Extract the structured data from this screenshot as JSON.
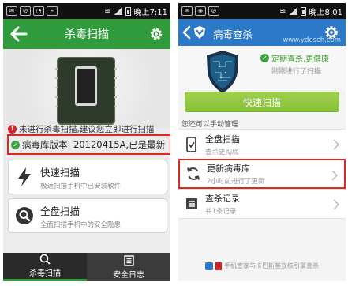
{
  "left": {
    "status_time": "晚上7:11",
    "title": "杀毒扫描",
    "warning": "未进行杀毒扫描,建议您立即进行扫描",
    "db_version": "病毒库版本: 20120415A,已是最新",
    "quick_scan": {
      "title": "快速扫描",
      "desc": "极速扫描手机中已安装软件"
    },
    "full_scan": {
      "title": "全盘扫描",
      "desc": "全面扫描手机中的安全隐患"
    },
    "tabs": [
      {
        "label": "杀毒扫描"
      },
      {
        "label": "安全日志"
      }
    ]
  },
  "right": {
    "status_time": "晚上8:01",
    "title": "病毒查杀",
    "watermark": "www.ydesch.com",
    "status_main": "定期查杀,更健康",
    "status_sub": "刚刚进行了扫描",
    "quick_scan_button": "快速扫描",
    "section_header": "您还可以手动管理",
    "items": [
      {
        "title": "全盘扫描",
        "desc": "查杀更彻底"
      },
      {
        "title": "更新病毒库",
        "desc": "2小时前进行了更新"
      },
      {
        "title": "查杀记录",
        "desc": "共1条记录"
      }
    ],
    "footer": "手机管家与卡巴斯基双核引擎查杀"
  },
  "colors": {
    "left_accent": "#2f9b3c",
    "right_accent": "#2b79c7",
    "highlight": "#e0281f",
    "button_green": "#8cc63f"
  }
}
